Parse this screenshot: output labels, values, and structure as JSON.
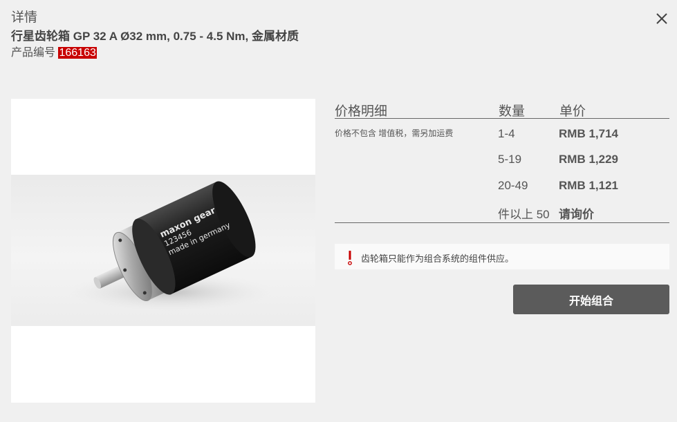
{
  "header": {
    "section_label": "详情",
    "title": "行星齿轮箱 GP 32 A Ø32 mm, 0.75 - 4.5 Nm, 金属材质",
    "product_number_label": "产品编号",
    "product_number": "166163"
  },
  "close_icon": "close-icon",
  "image": {
    "engraving": [
      "maxon gear",
      "123456",
      "made in germany"
    ]
  },
  "pricing": {
    "header": {
      "details": "价格明细",
      "quantity": "数量",
      "unit_price": "单价"
    },
    "note": "价格不包含 增值税，需另加运费",
    "rows": [
      {
        "quantity": "1-4",
        "price": "RMB 1,714"
      },
      {
        "quantity": "5-19",
        "price": "RMB 1,229"
      },
      {
        "quantity": "20-49",
        "price": "RMB 1,121"
      },
      {
        "quantity": "件以上 50",
        "price": "请询价"
      }
    ]
  },
  "info": {
    "icon": "exclamation-icon",
    "text": "齿轮箱只能作为组合系统的组件供应。",
    "accent_color": "#c80000"
  },
  "actions": {
    "start_combination": "开始组合"
  }
}
